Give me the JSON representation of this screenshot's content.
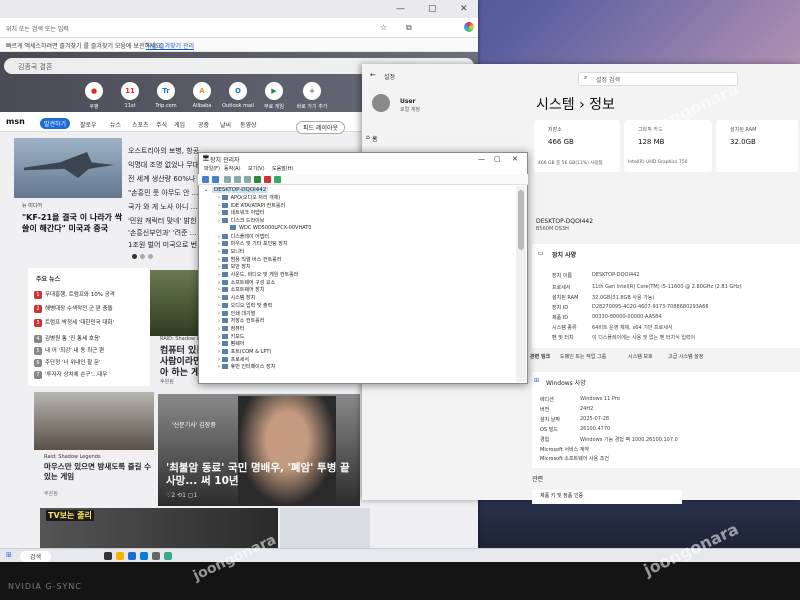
{
  "browser": {
    "address": "빠르게 액세스하려면 즐겨찾기 를 즐겨찾기 모음에 ...",
    "address_url": "위치 또는 검색 또는 입력",
    "fav_text": "빠르게 액세스하려면 즐겨찾기 를 즐겨찾기 모음에 보관하세요.",
    "fav_link": "지금 즐겨찾기 관리",
    "search_placeholder": "김종국 결혼",
    "tiles": [
      {
        "icon": "●",
        "label": "쿠팡",
        "color": "#e0262a"
      },
      {
        "icon": "11",
        "label": "11st",
        "color": "#e0262a"
      },
      {
        "icon": "Tr",
        "label": "Trip.com",
        "color": "#2a6fd6"
      },
      {
        "icon": "A",
        "label": "Alibaba",
        "color": "#f28a1b"
      },
      {
        "icon": "O",
        "label": "Outlook mail",
        "color": "#1e6fd0"
      },
      {
        "icon": "▶",
        "label": "무료 게임",
        "color": "#1a8a4a"
      },
      {
        "icon": "+",
        "label": "바로 가기 추가",
        "color": "#666666"
      }
    ]
  },
  "msn": {
    "logo": "msn",
    "tabs": [
      "발견하기",
      "팔로우",
      "뉴스",
      "스포츠",
      "주식",
      "게임",
      "공중",
      "날씨",
      "동영상"
    ],
    "feed_button": "피드 레이아웃",
    "card1": {
      "source": "뉴 미디어",
      "title": "\"KF-21을 결국 이 나라가 싹 쓸이 해간다\" 미국과 중국"
    },
    "headlines": [
      "오스트리아의 보병, 항공 ...",
      "익명대 조명 없었나 무대 ...",
      "전 세계 생산량 60%나 ...",
      "\"손흥민 풋 아무도 안 ...",
      "국가 와 게 노사 아니 ...",
      "'민원 캐릭터 맞네' 밝힌 ...",
      "'손흥신부인과' '려준 ...",
      "1조원 벌어 미국으로 번 ..."
    ],
    "list_title": "주요 뉴스",
    "list": [
      {
        "n": "1",
        "text": "무대흥행, 트럼프와 10% 공격"
      },
      {
        "n": "2",
        "text": "해병대장 수색작전 군 판 충돌"
      },
      {
        "n": "3",
        "text": "트럼프 박정세 '대한민국 대화'"
      },
      {
        "n": "4",
        "text": "김병원 통 '진 통세 호응'"
      },
      {
        "n": "5",
        "text": "내 어 '최강' 내 동 최근 편"
      },
      {
        "n": "6",
        "text": "주단정 '너 위내인 할 문'"
      },
      {
        "n": "7",
        "text": "'투자자 상치에 손구'...대우"
      }
    ],
    "mid": {
      "caption": "RAID: Shadow Legends",
      "title": "컴퓨터 있는 사람이라면 아 하는 게임",
      "source": "후원됨"
    },
    "botleft": {
      "source": "Raid: Shadow Legends",
      "title": "마우스만 있으면 방새도록 즐길 수 있는 게임",
      "more": "후원됨"
    },
    "botmain": {
      "tag": "'신문기사' 김장중",
      "title": "'최불암 동료' 국민 명배우, '폐암' 투병 끝 사망... 써 10년",
      "reactions": "♡2  ⟲1  ▢1"
    },
    "strip": "TV보는 줄리"
  },
  "taskbar": {
    "search": "검색"
  },
  "settings": {
    "title": "설정",
    "search": "설정 검색",
    "user": "User",
    "user_sub": "로컬 계정",
    "home": "홈",
    "heading": "시스템 › 정보",
    "specs": [
      {
        "label": "저장소",
        "value": "466 GB",
        "sub": "466 GB 중 56 GB(11%) 사용됨"
      },
      {
        "label": "그래픽 카드",
        "value": "128 MB",
        "sub": "Intel(R) UHD Graphics 750"
      },
      {
        "label": "설치된 RAM",
        "value": "32.0GB",
        "sub": ""
      }
    ],
    "device_name": "DESKTOP-DQOI442",
    "device_model": "B560M DS3H",
    "spec_title": "장치 사양",
    "spec_rows": [
      {
        "k": "장치 이름",
        "v": "DESKTOP-DQOI442"
      },
      {
        "k": "프로세서",
        "v": "11th Gen Intel(R) Core(TM) i5-11600 @ 2.80GHz (2.81 GHz)"
      },
      {
        "k": "설치된 RAM",
        "v": "32.0GB(31.8GB 사용 가능)"
      },
      {
        "k": "장치 ID",
        "v": "D28270095-4C20-4607-9173-7088680293A66"
      },
      {
        "k": "제품 ID",
        "v": "00330-80000-00000-AA584"
      },
      {
        "k": "시스템 종류",
        "v": "64비트 운영 체제, x64 기반 프로세서"
      },
      {
        "k": "펜 및 터치",
        "v": "이 디스플레이에는 사용 및 없는 펜 터치식 입력이"
      }
    ],
    "related": [
      "관련 링크",
      "도메인 또는 작업 그룹",
      "시스템 보호",
      "고급 시스템 설정"
    ],
    "win_title": "Windows 사양",
    "win_rows": [
      {
        "k": "에디션",
        "v": "Windows 11 Pro"
      },
      {
        "k": "버전",
        "v": "24H2"
      },
      {
        "k": "설치 날짜",
        "v": "2025-07-28"
      },
      {
        "k": "OS 빌드",
        "v": "26100.4770"
      },
      {
        "k": "경험",
        "v": "Windows 기능 경험 팩 1000.26100.107.0"
      },
      {
        "k": "Microsoft 서비스 계약",
        "v": ""
      },
      {
        "k": "Microsoft 소프트웨어 사용 조건",
        "v": ""
      }
    ],
    "prodkey": "관련",
    "prodkey2": "제품 키 및 정품 인증"
  },
  "devmgr": {
    "title": "장치 관리자",
    "menu": [
      "파일(F)",
      "동작(A)",
      "보기(V)",
      "도움말(H)"
    ],
    "root": "DESKTOP-DQOI442",
    "items": [
      {
        "t": "APO(오디오 처리 개체)",
        "sub": false
      },
      {
        "t": "IDE ATA/ATAPI 컨트롤러",
        "sub": false
      },
      {
        "t": "네트워크 어댑터",
        "sub": false
      },
      {
        "t": "디스크 드라이브",
        "sub": false
      },
      {
        "t": "WDC WD5000LPCX-00VHAT0",
        "sub": true
      },
      {
        "t": "디스플레이 어댑터",
        "sub": false
      },
      {
        "t": "마우스 및 기타 포인팅 장치",
        "sub": false
      },
      {
        "t": "모니터",
        "sub": false
      },
      {
        "t": "범용 직렬 버스 컨트롤러",
        "sub": false
      },
      {
        "t": "보안 장치",
        "sub": false
      },
      {
        "t": "사운드, 비디오 및 게임 컨트롤러",
        "sub": false
      },
      {
        "t": "소프트웨어 구성 요소",
        "sub": false
      },
      {
        "t": "소프트웨어 장치",
        "sub": false
      },
      {
        "t": "시스템 장치",
        "sub": false
      },
      {
        "t": "오디오 입력 및 출력",
        "sub": false
      },
      {
        "t": "인쇄 대기열",
        "sub": false
      },
      {
        "t": "저장소 컨트롤러",
        "sub": false
      },
      {
        "t": "컴퓨터",
        "sub": false
      },
      {
        "t": "키보드",
        "sub": false
      },
      {
        "t": "펌웨어",
        "sub": false
      },
      {
        "t": "포트(COM & LPT)",
        "sub": false
      },
      {
        "t": "프로세서",
        "sub": false
      },
      {
        "t": "휴먼 인터페이스 장치",
        "sub": false
      }
    ]
  },
  "bezel_brand": "NVIDIA   G-SYNC",
  "watermark": "joongonara"
}
